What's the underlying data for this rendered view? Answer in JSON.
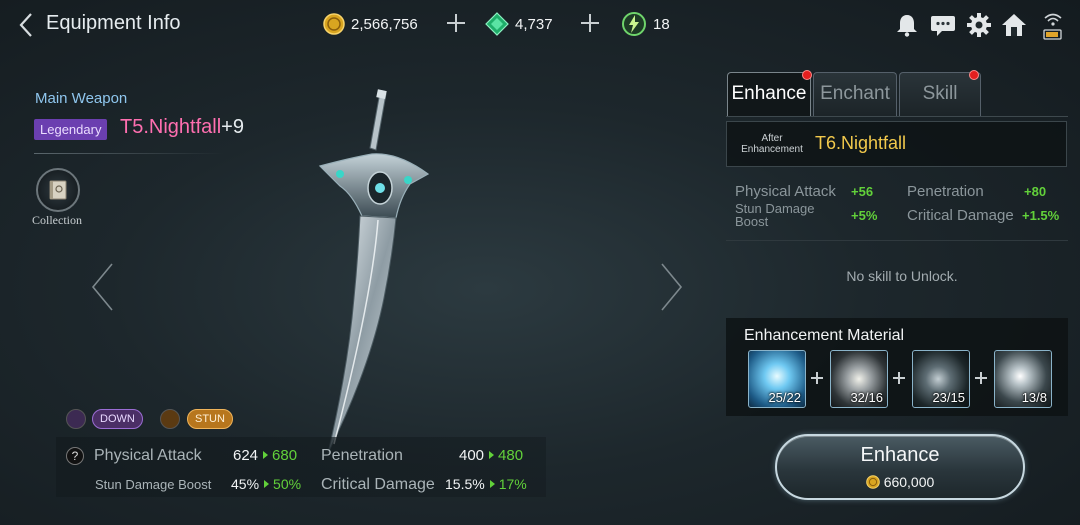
{
  "header": {
    "title": "Equipment Info",
    "gold": "2,566,756",
    "gems": "4,737",
    "tickets": "18"
  },
  "item": {
    "slot_label": "Main Weapon",
    "grade": "Legendary",
    "name": "T5.Nightfall",
    "level": "+9",
    "collection_label": "Collection"
  },
  "tags": [
    "DOWN",
    "STUN"
  ],
  "stats": {
    "physical_attack": {
      "label": "Physical Attack",
      "current": "624",
      "next": "680"
    },
    "penetration": {
      "label": "Penetration",
      "current": "400",
      "next": "480"
    },
    "stun_damage_boost": {
      "label": "Stun Damage Boost",
      "current": "45%",
      "next": "50%"
    },
    "critical_damage": {
      "label": "Critical Damage",
      "current": "15.5%",
      "next": "17%"
    }
  },
  "tabs": [
    {
      "label": "Enhance",
      "active": true,
      "badge": true
    },
    {
      "label": "Enchant",
      "active": false,
      "badge": false
    },
    {
      "label": "Skill",
      "active": false,
      "badge": true
    }
  ],
  "enhance": {
    "after_label_1": "After",
    "after_label_2": "Enhancement",
    "after_name": "T6.Nightfall",
    "bonuses": {
      "physical_attack": {
        "label": "Physical Attack",
        "value": "+56"
      },
      "penetration": {
        "label": "Penetration",
        "value": "+80"
      },
      "stun_damage_boost_1": "Stun Damage",
      "stun_damage_boost_2": "Boost",
      "stun_damage_boost_value": "+5%",
      "critical_damage": {
        "label": "Critical Damage",
        "value": "+1.5%"
      }
    },
    "skill_message": "No skill to Unlock.",
    "material_title": "Enhancement Material",
    "materials": [
      {
        "name": "ice-crystal",
        "count": "25/22"
      },
      {
        "name": "potion-jar",
        "count": "32/16"
      },
      {
        "name": "dark-claw",
        "count": "23/15"
      },
      {
        "name": "silver-blade",
        "count": "13/8"
      }
    ],
    "button_label": "Enhance",
    "cost": "660,000"
  },
  "colors": {
    "gain_green": "#62d13a",
    "legendary_pink": "#ff6fb0",
    "legendary_purple": "#6b3fb0",
    "next_tier_gold": "#f2c94c",
    "badge_red": "#e41f1f"
  }
}
